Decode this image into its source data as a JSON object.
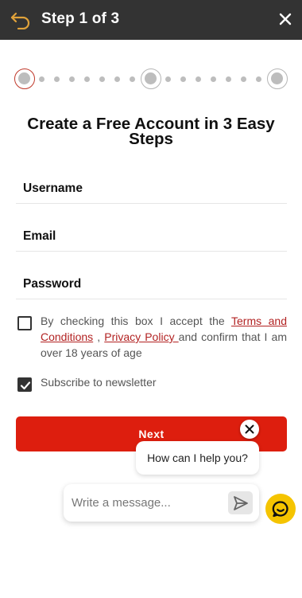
{
  "header": {
    "title": "Step 1 of 3",
    "back_icon": "back-arrow-icon",
    "close_icon": "close-icon"
  },
  "stepper": {
    "total_steps": 3,
    "current_step": 1,
    "active_color": "#c0392b"
  },
  "form": {
    "title": "Create a Free Account in 3 Easy Steps",
    "username_label": "Username",
    "email_label": "Email",
    "password_label": "Password",
    "terms": {
      "checked": false,
      "text_before": "By checking this box I accept the ",
      "terms_link": "Terms and Conditions",
      "separator": " , ",
      "privacy_link": "Privacy Policy ",
      "text_after": "and confirm that I am over 18 years of age"
    },
    "newsletter": {
      "checked": true,
      "label": "Subscribe to newsletter"
    },
    "next_label": "Next"
  },
  "chat": {
    "greeting": "How can I help you?",
    "placeholder": "Write a message...",
    "close_icon": "close-icon",
    "send_icon": "send-icon",
    "launcher_icon": "chat-bubble-icon",
    "launcher_color": "#f5c400"
  },
  "colors": {
    "header_bg": "#333333",
    "accent": "#dd1e0e",
    "link": "#b22222"
  }
}
